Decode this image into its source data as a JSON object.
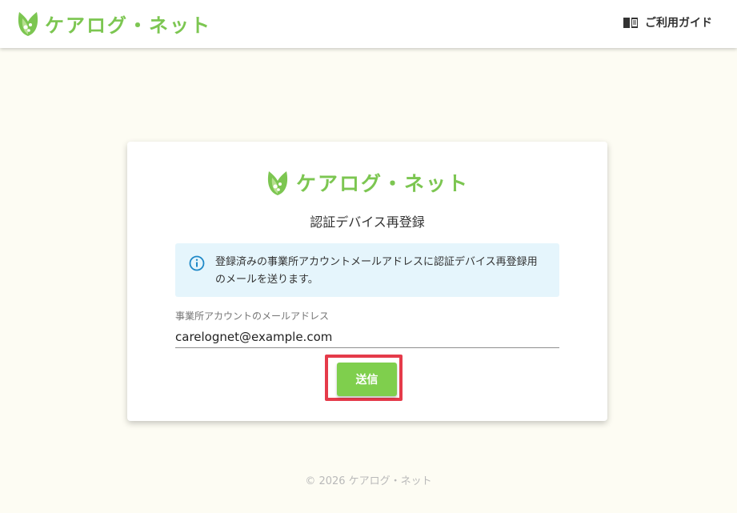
{
  "header": {
    "brand": "ケアログ・ネット",
    "guide_label": "ご利用ガイド",
    "guide_icon": "book-icon"
  },
  "card": {
    "brand": "ケアログ・ネット",
    "title": "認証デバイス再登録",
    "info": {
      "icon": "info-icon",
      "message": "登録済みの事業所アカウントメールアドレスに認証デバイス再登録用のメールを送ります。"
    },
    "email_field": {
      "label": "事業所アカウントのメールアドレス",
      "value": "carelognet@example.com"
    },
    "submit_label": "送信"
  },
  "footer": {
    "copyright": "© 2026 ケアログ・ネット"
  },
  "colors": {
    "brand_green": "#7cc651",
    "button_green": "#7fcf4d",
    "info_bg": "#e5f5fc",
    "info_icon": "#1e88c7",
    "highlight_red": "#e53b4a",
    "page_bg": "#fdfcf3"
  }
}
